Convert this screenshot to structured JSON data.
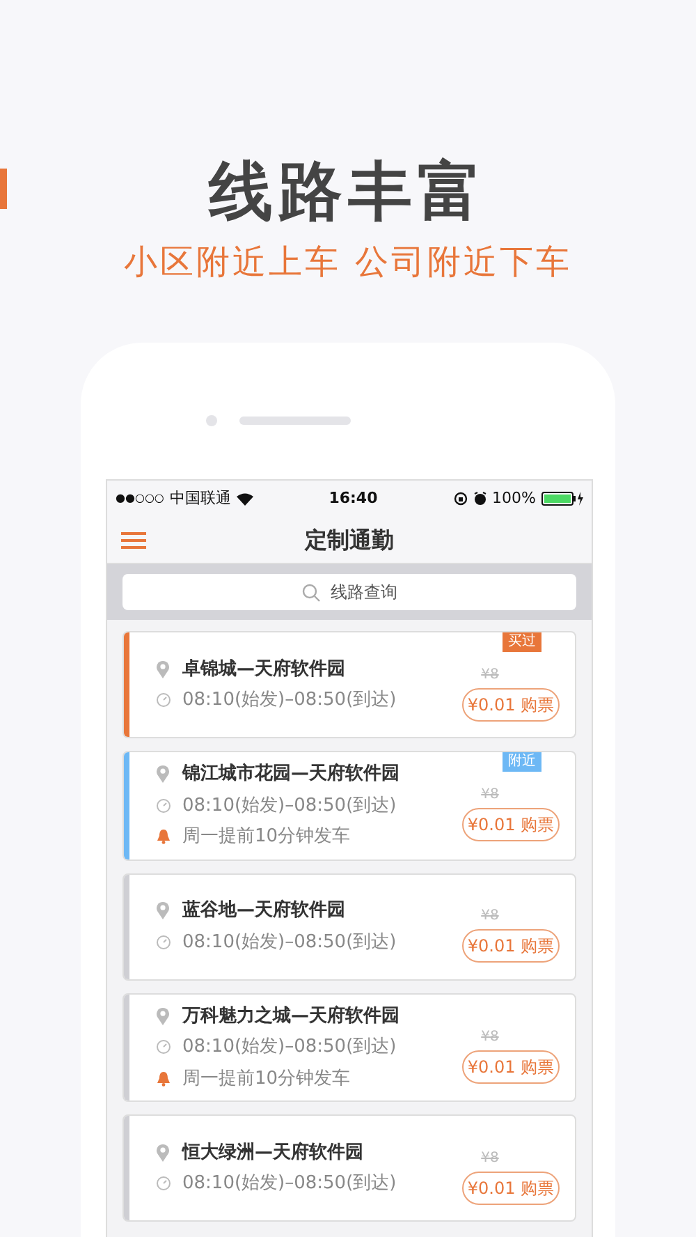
{
  "header": {
    "title": "线路丰富",
    "subtitle": "小区附近上车 公司附近下车"
  },
  "status_bar": {
    "signal": "●●○○○",
    "carrier": "中国联通",
    "time": "16:40",
    "battery": "100%"
  },
  "nav": {
    "title": "定制通勤"
  },
  "search": {
    "placeholder": "线路查询"
  },
  "routes": [
    {
      "name": "卓锦城—天府软件园",
      "time": "08:10(始发)–08:50(到达)",
      "color": "#e8763a",
      "tag": {
        "text": "买过",
        "color": "#e8763a"
      },
      "original_price": "¥8",
      "buy": "¥0.01 购票"
    },
    {
      "name": "锦江城市花园—天府软件园",
      "time": "08:10(始发)–08:50(到达)",
      "reminder": "周一提前10分钟发车",
      "color": "#6db8f5",
      "tag": {
        "text": "附近",
        "color": "#6db8f5"
      },
      "original_price": "¥8",
      "buy": "¥0.01 购票"
    },
    {
      "name": "蓝谷地—天府软件园",
      "time": "08:10(始发)–08:50(到达)",
      "color": "#cfcfd4",
      "original_price": "¥8",
      "buy": "¥0.01 购票"
    },
    {
      "name": "万科魅力之城—天府软件园",
      "time": "08:10(始发)–08:50(到达)",
      "reminder": "周一提前10分钟发车",
      "color": "#cfcfd4",
      "original_price": "¥8",
      "buy": "¥0.01 购票"
    },
    {
      "name": "恒大绿洲—天府软件园",
      "time": "08:10(始发)–08:50(到达)",
      "color": "#cfcfd4",
      "original_price": "¥8",
      "buy": "¥0.01 购票"
    }
  ]
}
